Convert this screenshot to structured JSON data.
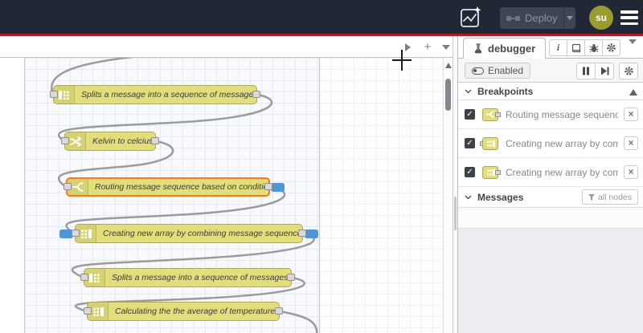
{
  "header": {
    "deploy": {
      "label": "Deploy"
    },
    "avatar": {
      "initials": "su"
    }
  },
  "canvas": {
    "nodes": [
      {
        "type": "split",
        "label": "Splits a message into a sequence of messages."
      },
      {
        "type": "change",
        "label": "Kelvin to celcius"
      },
      {
        "type": "switch",
        "label": "Routing message sequence based on condition",
        "selected": true,
        "breakpoint_out": true
      },
      {
        "type": "join",
        "label": "Creating new array by combining message sequence",
        "breakpoint_in": true,
        "breakpoint_out": true
      },
      {
        "type": "split",
        "label": "Splits a message into a sequence of messages."
      },
      {
        "type": "join",
        "label": "Calculating the the average of temperature"
      }
    ]
  },
  "sidebar": {
    "tab": {
      "label": "debugger"
    },
    "toolbar": {
      "enabled_label": "Enabled"
    },
    "breakpoints": {
      "title": "Breakpoints",
      "items": [
        {
          "label": "Routing message sequence based on condition",
          "checked": true
        },
        {
          "label": "Creating new array by combining message sequence",
          "checked": true
        },
        {
          "label": "Creating new array by combining message sequence",
          "checked": true
        }
      ]
    },
    "messages": {
      "title": "Messages",
      "filter_label": "all nodes"
    }
  },
  "colors": {
    "header_bg": "#212734",
    "accent_red": "#ab1b28",
    "node_yellow": "#e2de7b",
    "selected_orange": "#ff7913",
    "breakpoint_blue": "#4e96d8",
    "wire_grey": "#9b9b9b",
    "avatar_olive": "#9a9b31"
  }
}
